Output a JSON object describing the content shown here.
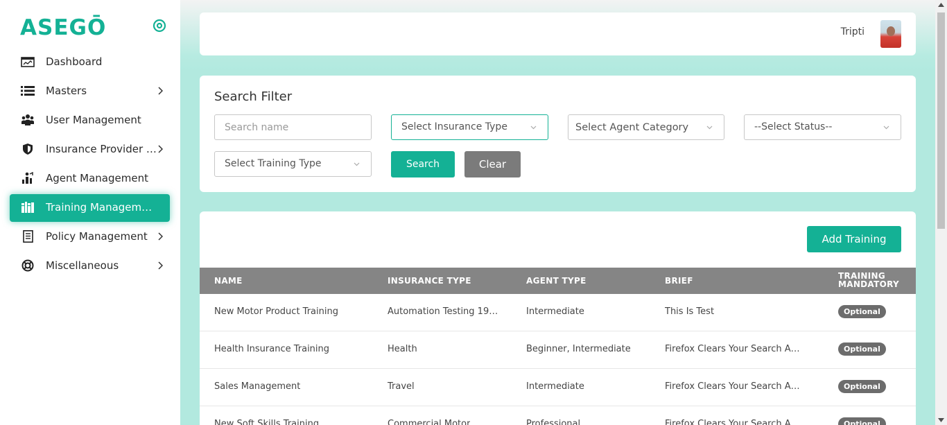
{
  "brand": {
    "logo_text": "ASEGŌ",
    "accent": "#14b195"
  },
  "sidebar": {
    "items": [
      {
        "label": "Dashboard",
        "icon": "dashboard-icon",
        "has_chevron": false,
        "active": false
      },
      {
        "label": "Masters",
        "icon": "list-icon",
        "has_chevron": true,
        "active": false
      },
      {
        "label": "User Management",
        "icon": "users-icon",
        "has_chevron": false,
        "active": false
      },
      {
        "label": "Insurance Provider Management",
        "icon": "shield-icon",
        "has_chevron": true,
        "active": false
      },
      {
        "label": "Agent Management",
        "icon": "agent-icon",
        "has_chevron": false,
        "active": false
      },
      {
        "label": "Training Management",
        "icon": "books-icon",
        "has_chevron": false,
        "active": true
      },
      {
        "label": "Policy Management",
        "icon": "document-icon",
        "has_chevron": true,
        "active": false
      },
      {
        "label": "Miscellaneous",
        "icon": "lifebuoy-icon",
        "has_chevron": true,
        "active": false
      }
    ]
  },
  "header": {
    "user_name": "Tripti"
  },
  "filter": {
    "title": "Search Filter",
    "search_placeholder": "Search name",
    "insurance_type": "Select Insurance Type",
    "agent_category": "Select Agent Category",
    "status": "--Select Status--",
    "training_type": "Select Training Type",
    "search_label": "Search",
    "clear_label": "Clear"
  },
  "table": {
    "add_label": "Add Training",
    "columns": [
      "NAME",
      "INSURANCE TYPE",
      "AGENT TYPE",
      "BRIEF",
      "TRAINING MANDATORY"
    ],
    "rows": [
      {
        "name": "New Motor Product Training",
        "insurance_type": "Automation Testing 19…",
        "agent_type": "Intermediate",
        "brief": "This Is Test",
        "mandatory": "Optional"
      },
      {
        "name": "Health Insurance Training",
        "insurance_type": "Health",
        "agent_type": "Beginner, Intermediate",
        "brief": "Firefox Clears Your Search A…",
        "mandatory": "Optional"
      },
      {
        "name": "Sales Management",
        "insurance_type": "Travel",
        "agent_type": "Intermediate",
        "brief": "Firefox Clears Your Search A…",
        "mandatory": "Optional"
      },
      {
        "name": "New Soft Skills Training",
        "insurance_type": "Commercial Motor",
        "agent_type": "Professional",
        "brief": "Firefox Clears Your Search A…",
        "mandatory": "Optional"
      }
    ]
  }
}
